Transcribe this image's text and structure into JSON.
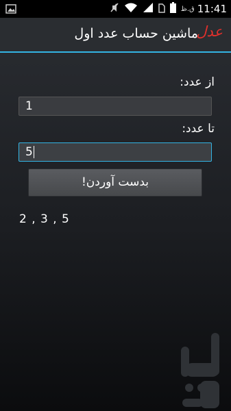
{
  "status_bar": {
    "time": "11:41",
    "ampm": "ق.ظ",
    "icons": [
      "image-notification-icon",
      "muted-icon",
      "wifi-icon",
      "signal-icon",
      "sim-icon",
      "battery-icon"
    ]
  },
  "action_bar": {
    "logo_text": "عدل",
    "title": "ماشین حساب عدد اول"
  },
  "form": {
    "from_label": "از عدد:",
    "from_value": "1",
    "to_label": "تا عدد:",
    "to_value": "5",
    "compute_button": "بدست آوردن!"
  },
  "result": {
    "text": "2 , 3 , 5"
  },
  "colors": {
    "accent": "#33b5e5",
    "logo": "#e0302c"
  }
}
